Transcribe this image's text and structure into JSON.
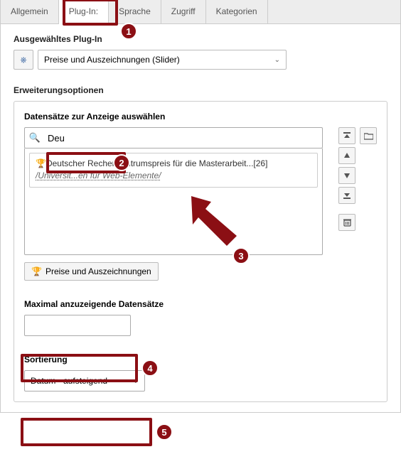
{
  "tabs": {
    "items": [
      {
        "label": "Allgemein",
        "name": "tab-allgemein"
      },
      {
        "label": "Plug-In:",
        "name": "tab-plugin"
      },
      {
        "label": "Sprache",
        "name": "tab-sprache"
      },
      {
        "label": "Zugriff",
        "name": "tab-zugriff"
      },
      {
        "label": "Kategorien",
        "name": "tab-kategorien"
      }
    ],
    "active_index": 1
  },
  "selected_plugin": {
    "label": "Ausgewähltes Plug-In",
    "value": "Preise und Auszeichnungen (Slider)"
  },
  "extension": {
    "heading": "Erweiterungsoptionen",
    "records_label": "Datensätze zur Anzeige auswählen",
    "search_value": "Deu",
    "suggestion_line1": "Deutscher Rechenzentrumspreis für die Masterarbeit...[26]",
    "suggestion_line2": "/Universit...en für Web-Elemente/",
    "tag_button": "Preise und Auszeichnungen"
  },
  "max_records": {
    "label": "Maximal anzuzeigende Datensätze",
    "value": ""
  },
  "sorting": {
    "label": "Sortierung",
    "value": "Datum - aufsteigend"
  },
  "annotations": {
    "badge1": "1",
    "badge2": "2",
    "badge3": "3",
    "badge4": "4",
    "badge5": "5"
  },
  "colors": {
    "annotation": "#8b0f14"
  }
}
